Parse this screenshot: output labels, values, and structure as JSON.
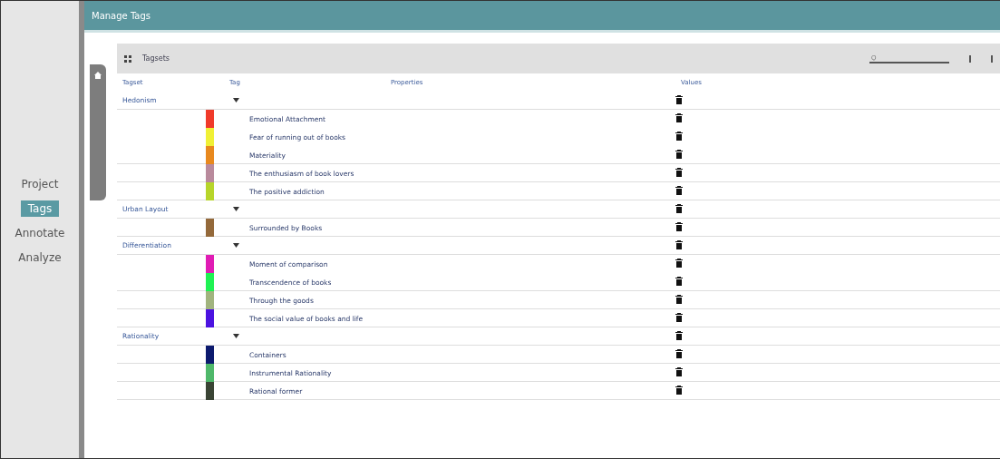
{
  "sidebar": {
    "items": [
      {
        "label": "Project",
        "selected": false
      },
      {
        "label": "Tags",
        "selected": true
      },
      {
        "label": "Annotate",
        "selected": false
      },
      {
        "label": "Analyze",
        "selected": false
      }
    ]
  },
  "header": {
    "title": "Manage Tags"
  },
  "toolbar": {
    "title": "Tagsets",
    "search": {
      "placeholder": "Q"
    }
  },
  "table": {
    "columns": [
      "Tagset",
      "Tag",
      "Properties",
      "Values"
    ],
    "groups": [
      {
        "name": "Hedonism",
        "tags": [
          {
            "name": "Emotional Attachment",
            "color": "#f03a2a"
          },
          {
            "name": "Fear of running out of books",
            "color": "#f0f035"
          },
          {
            "name": "Materiality",
            "color": "#e8891e"
          },
          {
            "name": "The enthusiasm of book lovers",
            "color": "#b98a9c"
          },
          {
            "name": "The positive addiction",
            "color": "#b7d52a"
          }
        ]
      },
      {
        "name": "Urban Layout",
        "tags": [
          {
            "name": "Surrounded by Books",
            "color": "#94693a"
          }
        ]
      },
      {
        "name": "Differentiation",
        "tags": [
          {
            "name": "Moment of comparison",
            "color": "#e01cb4"
          },
          {
            "name": "Transcendence of books",
            "color": "#1ff253"
          },
          {
            "name": "Through the goods",
            "color": "#a1b47e"
          },
          {
            "name": "The social value of books and life",
            "color": "#4b12e0"
          }
        ]
      },
      {
        "name": "Rationality",
        "tags": [
          {
            "name": "Containers",
            "color": "#0c1a6e"
          },
          {
            "name": "Instrumental Rationality",
            "color": "#4fb86a"
          },
          {
            "name": "Rational former",
            "color": "#3a4434"
          }
        ]
      }
    ]
  }
}
